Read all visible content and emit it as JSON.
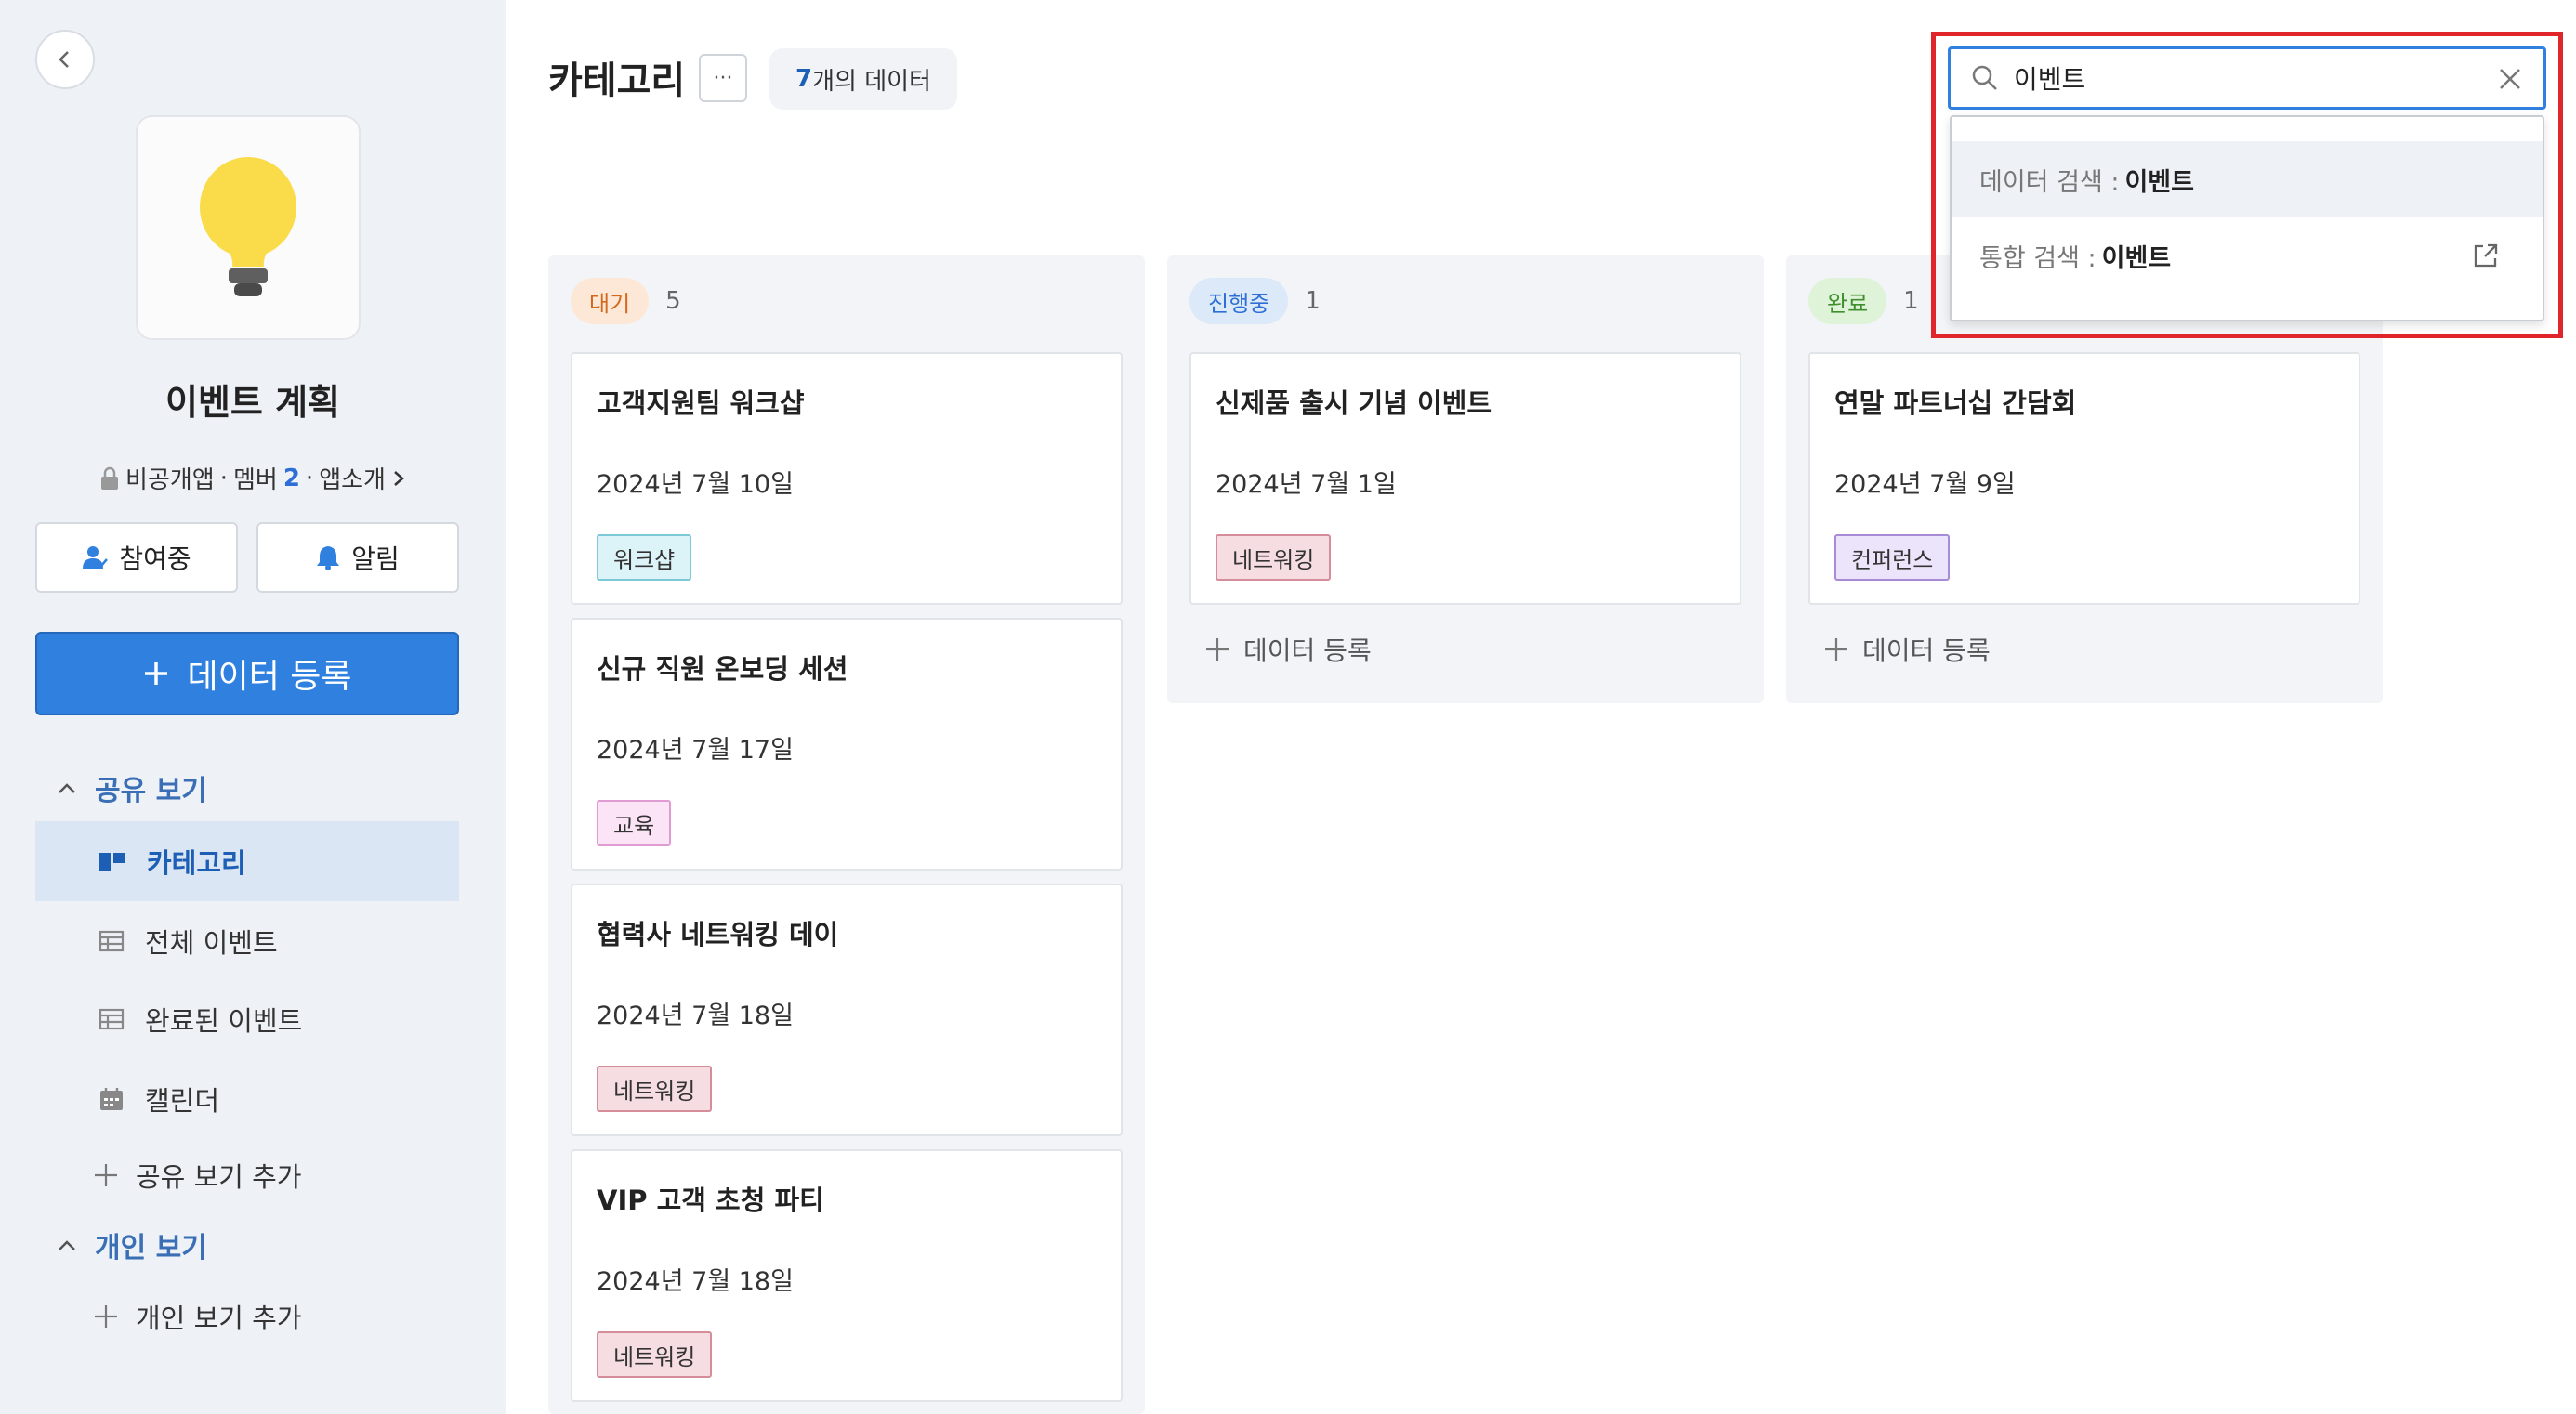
{
  "sidebar": {
    "app_name": "이벤트 계획",
    "meta": {
      "visibility": "비공개앱",
      "members_label": "멤버",
      "members_count": "2",
      "intro": "앱소개"
    },
    "join_label": "참여중",
    "alarm_label": "알림",
    "register_label": "데이터 등록",
    "shared_section": "공유 보기",
    "shared_items": [
      "카테고리",
      "전체 이벤트",
      "완료된 이벤트",
      "캘린더"
    ],
    "add_shared": "공유 보기 추가",
    "personal_section": "개인 보기",
    "add_personal": "개인 보기 추가"
  },
  "header": {
    "title": "카테고리",
    "more": "···",
    "count_num": "7",
    "count_text": "개의 데이터"
  },
  "columns": [
    {
      "status": "대기",
      "count": "5",
      "cards": [
        {
          "title": "고객지원팀 워크샵",
          "date": "2024년 7월 10일",
          "tag": "워크샵"
        },
        {
          "title": "신규 직원 온보딩 세션",
          "date": "2024년 7월 17일",
          "tag": "교육"
        },
        {
          "title": "협력사 네트워킹 데이",
          "date": "2024년 7월 18일",
          "tag": "네트워킹"
        },
        {
          "title": "VIP 고객 초청 파티",
          "date": "2024년 7월 18일",
          "tag": "네트워킹"
        }
      ]
    },
    {
      "status": "진행중",
      "count": "1",
      "add_label": "데이터 등록",
      "cards": [
        {
          "title": "신제품 출시 기념 이벤트",
          "date": "2024년 7월 1일",
          "tag": "네트워킹"
        }
      ]
    },
    {
      "status": "완료",
      "count": "1",
      "add_label": "데이터 등록",
      "cards": [
        {
          "title": "연말 파트너십 간담회",
          "date": "2024년 7월 9일",
          "tag": "컨퍼런스"
        }
      ]
    }
  ],
  "search": {
    "value": "이벤트",
    "options": [
      {
        "label": "데이터 검색 : ",
        "keyword": "이벤트"
      },
      {
        "label": "통합 검색 : ",
        "keyword": "이벤트"
      }
    ]
  },
  "colors": {
    "accent": "#2f80df",
    "highlight": "#e0262b",
    "status_waiting_bg": "#fde8d7",
    "status_progress_bg": "#dce9f8",
    "status_done_bg": "#dff3d8"
  },
  "icons": [
    "chevron-left-icon",
    "lightbulb-icon",
    "lock-icon",
    "chevron-right-icon",
    "user-icon",
    "bell-icon",
    "plus-icon",
    "chevron-up-icon",
    "board-icon",
    "table-icon",
    "calendar-icon",
    "search-icon",
    "close-icon",
    "external-link-icon"
  ]
}
